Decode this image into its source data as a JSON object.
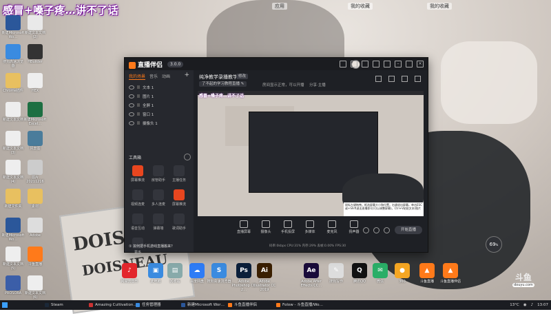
{
  "overlay_title": "感冒+嗓子疼…讲不了话",
  "browser_tabs": [
    "应用",
    "我的收藏",
    "我的收藏"
  ],
  "desktop_icons": [
    {
      "label": "新建Microsoft Wo…",
      "color": "#2b579a"
    },
    {
      "label": "新建文本文档 (2)",
      "color": "#e9e9e9"
    },
    {
      "label": "搜狗高速浏览器",
      "color": "#3a8be0"
    },
    {
      "label": "HBuilder",
      "color": "#333"
    },
    {
      "label": "Chrome插件",
      "color": "#e8c060"
    },
    {
      "label": "HEX",
      "color": "#eee"
    },
    {
      "label": "新建文本文档",
      "color": "#eee"
    },
    {
      "label": "新建Microsoft Excel…",
      "color": "#1d6f42"
    },
    {
      "label": "新建文本文档 (3)",
      "color": "#eee"
    },
    {
      "label": "风景图",
      "color": "#4a7c9b"
    },
    {
      "label": "新建文本文档 (4)",
      "color": "#eee"
    },
    {
      "label": "图片20211216",
      "color": "#ccc"
    },
    {
      "label": "新建文件夹",
      "color": "#e8c060"
    },
    {
      "label": "素材",
      "color": "#e8c060"
    },
    {
      "label": "新建Microsoft Wo…",
      "color": "#2b579a"
    },
    {
      "label": "Adobe",
      "color": "#ddd"
    },
    {
      "label": "新建文本文档 (5)",
      "color": "#eee"
    },
    {
      "label": "斗鱼直播",
      "color": "#ff7a1a"
    },
    {
      "label": "PROSORA",
      "color": "#3b5ea8"
    },
    {
      "label": "新建文本文档 (6)",
      "color": "#eee"
    }
  ],
  "taskbar_apps": [
    {
      "label": "网易云音乐",
      "color": "#e3262c",
      "glyph": "♪"
    },
    {
      "label": "此电脑",
      "color": "#3a8be0",
      "glyph": "▣"
    },
    {
      "label": "回收站",
      "color": "#8aa",
      "glyph": "▤"
    },
    {
      "label": "百度网盘",
      "color": "#2e7cf6",
      "glyph": "☁"
    },
    {
      "label": "搜狗高速浏览器",
      "color": "#3a8be0",
      "glyph": "S"
    },
    {
      "label": "Adobe Photoshop CC 2…",
      "color": "#0b1f3a",
      "glyph": "Ps"
    },
    {
      "label": "Adobe Illustrator CC 2019",
      "color": "#3a1f00",
      "glyph": "Ai"
    },
    {
      "label": "Adobe After Effects CC…",
      "color": "#1a0b3a",
      "glyph": "Ae"
    },
    {
      "label": "搜狗写作",
      "color": "#ddd",
      "glyph": "✎"
    },
    {
      "label": "腾讯QQ",
      "color": "#111",
      "glyph": "Q"
    },
    {
      "label": "微信",
      "color": "#2aae67",
      "glyph": "✉"
    },
    {
      "label": "360",
      "color": "#f5a623",
      "glyph": "●"
    },
    {
      "label": "斗鱼直播",
      "color": "#ff7a1a",
      "glyph": "▲"
    },
    {
      "label": "斗鱼直播伴侣",
      "color": "#ff7a1a",
      "glyph": "▲"
    }
  ],
  "app": {
    "name": "直播伴侣",
    "version": "3.0.0",
    "sidebar_tabs": [
      "我的场景",
      "音乐",
      "动画"
    ],
    "layers": [
      "文本 1",
      "图片 1",
      "全屏 1",
      "窗口 1",
      "摄像头 1"
    ],
    "tools_title": "工具箱",
    "tools": [
      "屏幕推流",
      "房管助手",
      "主播任务",
      "视频连麦",
      "多人连麦",
      "屏幕推流",
      "语音互动",
      "弹幕墙",
      "歌词助手",
      "更多"
    ],
    "notice": "① 如何把手机游戏直播搬来？",
    "room_title": "纯净教学录播教学",
    "room_tag": "修改",
    "room_category": "了不起的学习教程直播 ✎",
    "room_line2": "房间显示正常，可以开播",
    "room_line3": "分享·主播",
    "preview_title": "感冒+嗓子疼…讲不了话",
    "tooltip": "鼠标左键拖拽，框选屏幕大小和位置，右键退出屏幕。单击ESC或+Shift退出直播即可(可以调整屏幕)。Ctrl+V粘贴文本/图片",
    "controls": [
      "直播屏幕",
      "摄像头",
      "手机投屏",
      "多媒体",
      "麦克风",
      "扬声器"
    ],
    "start_label": "开始直播",
    "status": "码率:0kbps  CPU:31%  内存:29%  丢帧:0.00%  FPS:30"
  },
  "score_badge": "69",
  "douyu": {
    "logo": "斗鱼",
    "sub": "douyu.com"
  },
  "taskbar": {
    "items": [
      "Steam",
      "Amazing Cultivation…",
      "任务管理器",
      "新建Microsoft Wor…",
      "斗鱼直播伴侣",
      "Folow - 斗鱼直播/Wo…"
    ],
    "weather": "13°C",
    "clock": "13:07"
  }
}
